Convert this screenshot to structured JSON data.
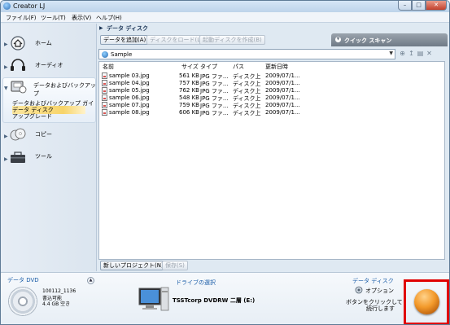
{
  "window": {
    "title": "Creator LJ"
  },
  "menubar": {
    "items": [
      "ファイル(F)",
      "ツール(T)",
      "表示(V)",
      "ヘルプ(H)"
    ]
  },
  "nav": {
    "items": [
      {
        "label": "ホーム",
        "icon": "home-icon"
      },
      {
        "label": "オーディオ",
        "icon": "headphones-icon"
      },
      {
        "label": "データおよびバックアップ",
        "icon": "backup-icon"
      },
      {
        "label": "コピー",
        "icon": "copy-disc-icon"
      },
      {
        "label": "ツール",
        "icon": "toolbox-icon"
      }
    ],
    "subitems": [
      "データおよびバックアップ ガイド",
      "データ ディスク",
      "アップグレード"
    ]
  },
  "panel": {
    "title": "データ ディスク",
    "quickscan_label": "クイック スキャン"
  },
  "toolbar": {
    "add_data": "データを追加(A)",
    "load_disc": "ディスクをロード(L)",
    "make_boot": "起動ディスクを作成(B)"
  },
  "pathbar": {
    "path": "Sample"
  },
  "filelist": {
    "columns": [
      "名前",
      "サイズ",
      "タイプ",
      "パス",
      "更新日時"
    ],
    "rows": [
      {
        "name": "sample 03.jpg",
        "size": "561 KB",
        "type": "JPG ファ...",
        "path": "ディスク上",
        "modified": "2009/07/1..."
      },
      {
        "name": "sample 04.jpg",
        "size": "757 KB",
        "type": "JPG ファ...",
        "path": "ディスク上",
        "modified": "2009/07/1..."
      },
      {
        "name": "sample 05.jpg",
        "size": "762 KB",
        "type": "JPG ファ...",
        "path": "ディスク上",
        "modified": "2009/07/1..."
      },
      {
        "name": "sample 06.jpg",
        "size": "548 KB",
        "type": "JPG ファ...",
        "path": "ディスク上",
        "modified": "2009/07/1..."
      },
      {
        "name": "sample 07.jpg",
        "size": "759 KB",
        "type": "JPG ファ...",
        "path": "ディスク上",
        "modified": "2009/07/1..."
      },
      {
        "name": "sample 08.jpg",
        "size": "606 KB",
        "type": "JPG ファ...",
        "path": "ディスク上",
        "modified": "2009/07/1..."
      }
    ]
  },
  "bottom": {
    "new_project": "新しいプロジェクト(N)",
    "save": "保存(S)"
  },
  "footer": {
    "dvd_title": "データ DVD",
    "dvd_line1": "100112_1136",
    "dvd_line2": "書込可能",
    "dvd_line3": "4.4 GB 空き",
    "drive_title": "ドライブの選択",
    "drive_name": "TSSTcorp DVDRW 二層 (E:)",
    "data_disc_title": "データ ディスク",
    "option_label": "オプション",
    "instruction_line1": "ボタンをクリックして",
    "instruction_line2": "続行します"
  }
}
